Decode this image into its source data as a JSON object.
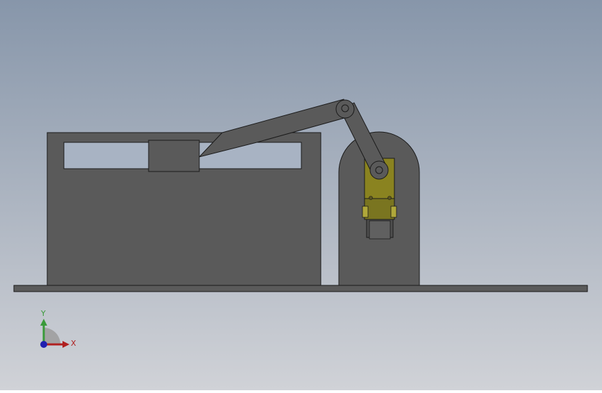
{
  "viewport": {
    "background_top": "#8796aa",
    "background_bottom": "#d0d2d7"
  },
  "model": {
    "body_color": "#5a5a5a",
    "outline_color": "#1a1a1a",
    "accent_color": "#8a8320",
    "accent_light": "#b0a83a"
  },
  "triad": {
    "y_label": "Y",
    "x_label": "X",
    "y_color": "#3a9a3a",
    "x_color": "#b02020",
    "z_color": "#2020b0"
  }
}
